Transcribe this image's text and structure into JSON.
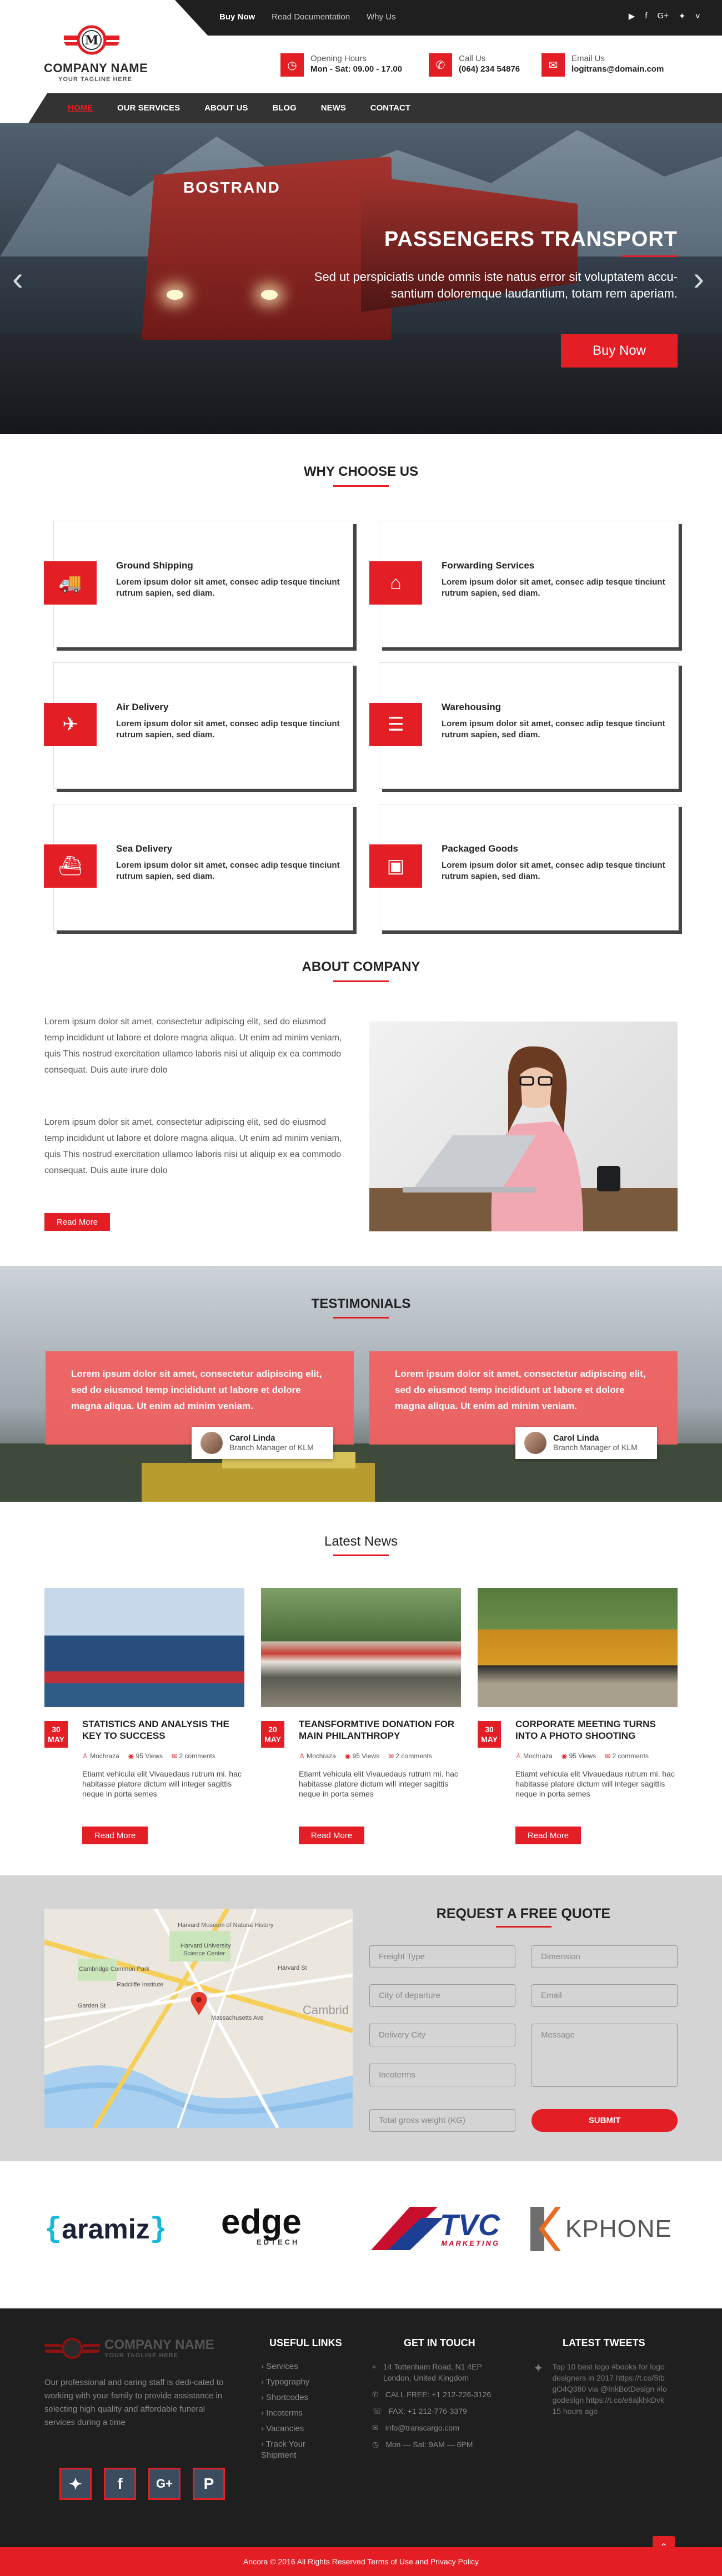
{
  "topbar": {
    "links": [
      "Buy Now",
      "Read Documentation",
      "Why Us"
    ],
    "social_icons": [
      "youtube-icon",
      "facebook-icon",
      "google-plus-icon",
      "twitter-icon",
      "vimeo-icon"
    ]
  },
  "logo": {
    "letter": "M",
    "name": "COMPANY NAME",
    "tagline": "YOUR TAGLINE HERE"
  },
  "contacts": [
    {
      "icon": "clock-icon",
      "label": "Opening Hours",
      "value": "Mon - Sat: 09.00 - 17.00"
    },
    {
      "icon": "phone-icon",
      "label": "Call Us",
      "value": "(064) 234 54876"
    },
    {
      "icon": "mail-icon",
      "label": "Email Us",
      "value": "logitrans@domain.com"
    }
  ],
  "nav": {
    "items": [
      "HOME",
      "OUR SERVICES",
      "ABOUT US",
      "BLOG",
      "NEWS",
      "CONTACT"
    ],
    "active": 0
  },
  "hero": {
    "brand": "BOSTRAND",
    "title": "PASSENGERS TRANSPORT",
    "subtitle_line1": "Sed ut perspiciatis unde omnis iste natus error sit voluptatem accu-",
    "subtitle_line2": "santium doloremque laudantium, totam rem aperiam.",
    "button": "Buy Now",
    "prev": "‹",
    "next": "›"
  },
  "why": {
    "title": "WHY CHOOSE US",
    "services": [
      {
        "icon": "truck-icon",
        "title": "Ground Shipping",
        "text": "Lorem ipsum dolor sit amet, consec adip tesque tinciunt rutrum sapien, sed diam."
      },
      {
        "icon": "warehouse-forward-icon",
        "title": "Forwarding Services",
        "text": "Lorem ipsum dolor sit amet, consec adip tesque tinciunt rutrum sapien, sed diam."
      },
      {
        "icon": "airplane-icon",
        "title": "Air Delivery",
        "text": "Lorem ipsum dolor sit amet, consec adip tesque tinciunt rutrum sapien, sed diam."
      },
      {
        "icon": "server-icon",
        "title": "Warehousing",
        "text": "Lorem ipsum dolor sit amet, consec adip tesque tinciunt rutrum sapien, sed diam."
      },
      {
        "icon": "ship-icon",
        "title": "Sea Delivery",
        "text": "Lorem ipsum dolor sit amet, consec adip tesque tinciunt rutrum sapien, sed diam."
      },
      {
        "icon": "box-icon",
        "title": "Packaged Goods",
        "text": "Lorem ipsum dolor sit amet, consec adip tesque tinciunt rutrum sapien, sed diam."
      }
    ]
  },
  "about": {
    "title": "ABOUT COMPANY",
    "p1": "Lorem ipsum dolor sit amet, consectetur adipiscing elit, sed do eiusmod temp incididunt ut labore et dolore magna aliqua. Ut enim ad minim veniam, quis This nostrud exercitation ullamco laboris nisi ut aliquip ex ea commodo consequat. Duis aute irure dolo",
    "p2": "Lorem ipsum dolor sit amet, consectetur adipiscing elit, sed do eiusmod temp incididunt ut labore et dolore magna aliqua. Ut enim ad minim veniam, quis This nostrud exercitation ullamco laboris nisi ut aliquip ex ea commodo consequat. Duis aute irure dolo",
    "button": "Read More"
  },
  "testimonials": {
    "title": "TESTIMONIALS",
    "items": [
      {
        "text": "Lorem ipsum dolor sit amet, consectetur adipiscing elit, sed do eiusmod temp incididunt ut labore et dolore magna aliqua. Ut enim ad minim veniam.",
        "name": "Carol Linda",
        "role": "Branch Manager of KLM"
      },
      {
        "text": "Lorem ipsum dolor sit amet, consectetur adipiscing elit, sed do eiusmod temp incididunt ut labore et dolore magna aliqua. Ut enim ad minim veniam.",
        "name": "Carol Linda",
        "role": "Branch Manager of KLM"
      }
    ]
  },
  "news": {
    "title": "Latest News",
    "items": [
      {
        "day": "30",
        "month": "MAY",
        "title": "STATISTICS AND ANALYSIS THE KEY TO SUCCESS",
        "author": "Mochraza",
        "views": "95 Views",
        "comments": "2 comments",
        "text": "Etiamt vehicula elit Vivauedaus rutrum mi. hac habitasse platore dictum will integer sagittis neque in porta semes",
        "button": "Read More"
      },
      {
        "day": "20",
        "month": "MAY",
        "title": "TEANSFORMTIVE DONATION FOR MAIN PHILANTHROPY",
        "author": "Mochraza",
        "views": "95 Views",
        "comments": "2 comments",
        "text": "Etiamt vehicula elit Vivauedaus rutrum mi. hac habitasse platore dictum will integer sagittis neque in porta semes",
        "button": "Read More"
      },
      {
        "day": "30",
        "month": "MAY",
        "title": "CORPORATE MEETING TURNS INTO A PHOTO SHOOTING",
        "author": "Mochraza",
        "views": "95 Views",
        "comments": "2 comments",
        "text": "Etiamt vehicula elit Vivauedaus rutrum mi. hac habitasse platore dictum will integer sagittis neque in porta semes",
        "button": "Read More"
      }
    ]
  },
  "quote": {
    "title": "REQUEST A FREE QUOTE",
    "fields": {
      "freight_type": "Freight Type",
      "dimension": "Dimension",
      "city_departure": "City of departure",
      "email": "Email",
      "delivery_city": "Delivery City",
      "message": "Message",
      "incoterms": "Incoterms",
      "weight": "Total gross weight (KG)"
    },
    "submit": "SUBMIT",
    "map_labels": {
      "museum": "Harvard Museum of Natural History",
      "university": "Harvard University",
      "science": "Science Center",
      "cambridge": "Cambridge Common Park",
      "radcliffe": "Radcliffe Institute",
      "garden": "Garden St",
      "mass": "Massachusetts Ave",
      "harvard_st": "Harvard St",
      "cambridge_label": "Cambrid"
    }
  },
  "brands": [
    "aramiz",
    "edge",
    "EDTECH",
    "TVC",
    "MARKETING",
    "KPHONE"
  ],
  "footer": {
    "logo_name": "COMPANY NAME",
    "logo_tagline": "YOUR TAGLINE HERE",
    "about": "Our professional and caring staff is dedi-cated to working with your family to provide assistance in selecting high quality and affordable funeral services during a time",
    "useful_title": "USEFUL LINKS",
    "useful_links": [
      "Services",
      "Typography",
      "Shortcodes",
      "Incoterms",
      "Vacancies",
      "Track Your Shipment"
    ],
    "touch_title": "GET IN TOUCH",
    "address_line1": "14 Tottenham Road, N1 4EP",
    "address_line2": "London, United Kingdom",
    "call_free": "CALL FREE: +1 212-226-3126",
    "fax": "FAX: +1 212-776-3379",
    "email": "info@transcargo.com",
    "hours": "Mon — Sat: 9AM — 6PM",
    "tweets_title": "LATEST TWEETS",
    "tweet": "Top 10 best logo #books for logo designers in 2017 https://t.co/5tbgO4Q380 via @InkBotDesign #logodesign https://t.co/e8ajkhkDvk",
    "tweet_time": "15 hours ago",
    "social": [
      "twitter-icon",
      "facebook-icon",
      "google-plus-icon",
      "pinterest-icon"
    ]
  },
  "copyright": "Ancora © 2016 All Rights Reserved Terms of Use and Privacy Policy",
  "colors": {
    "accent": "#e31e24",
    "dark": "#1f1f1f"
  }
}
